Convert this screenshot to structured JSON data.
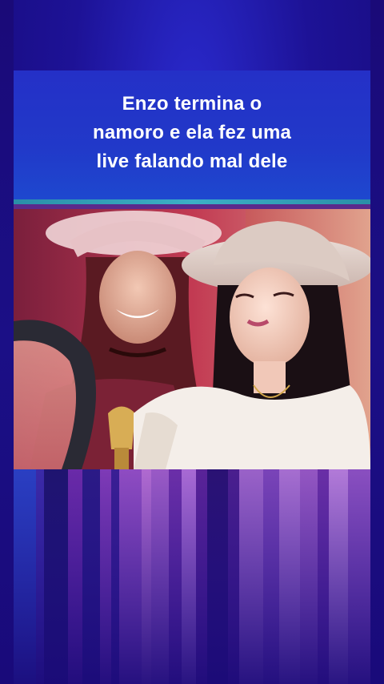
{
  "caption": {
    "line1": "Enzo termina o",
    "line2": "namoro e ela fez uma",
    "line3": "live falando mal dele"
  },
  "colors": {
    "background": "#1c0a86",
    "header_panel": "#2430c7",
    "accent_strip": "#3cb0c6",
    "caption_text": "#ffffff"
  },
  "media": {
    "scene": "video-frame-woman-in-cowboy-hat"
  }
}
